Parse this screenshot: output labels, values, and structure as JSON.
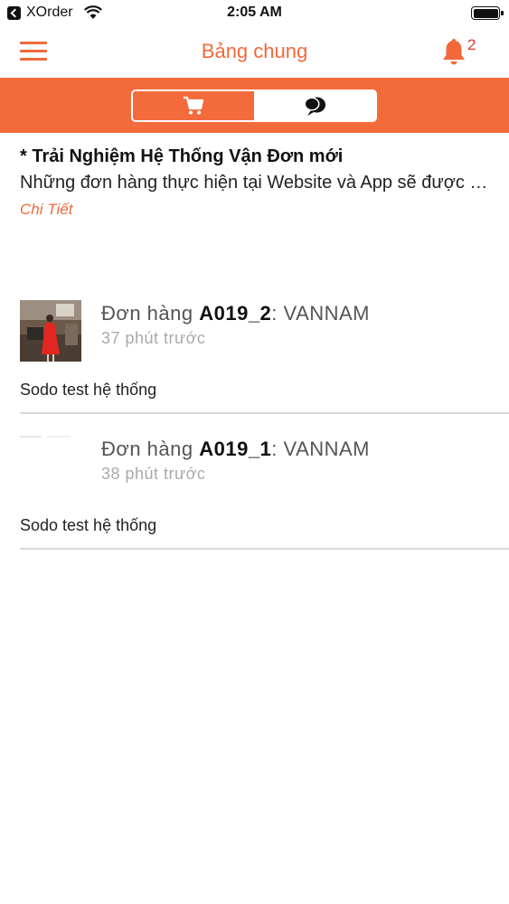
{
  "status_bar": {
    "app_name": "XOrder",
    "time": "2:05 AM"
  },
  "nav": {
    "title": "Bảng chung",
    "notification_count": "2"
  },
  "tabs": [
    {
      "icon": "cart-icon",
      "selected": false
    },
    {
      "icon": "chat-bubbles-icon",
      "selected": true
    }
  ],
  "colors": {
    "accent": "#f46b3b",
    "badge": "#e0352b"
  },
  "announcement": {
    "title": "* Trải Nghiệm Hệ Thống Vận Đơn mới",
    "body": "Những đơn hàng thực hiện tại Website và App sẽ được xử lý",
    "link": "Chi Tiết"
  },
  "orders": [
    {
      "prefix": "Đơn hàng ",
      "code": "A019_2",
      "suffix": ": VANNAM",
      "time": "37 phút trước",
      "message": "Sodo test hệ thống"
    },
    {
      "prefix": "Đơn hàng ",
      "code": "A019_1",
      "suffix": ": VANNAM",
      "time": "38 phút trước",
      "message": "Sodo test hệ thống"
    }
  ]
}
